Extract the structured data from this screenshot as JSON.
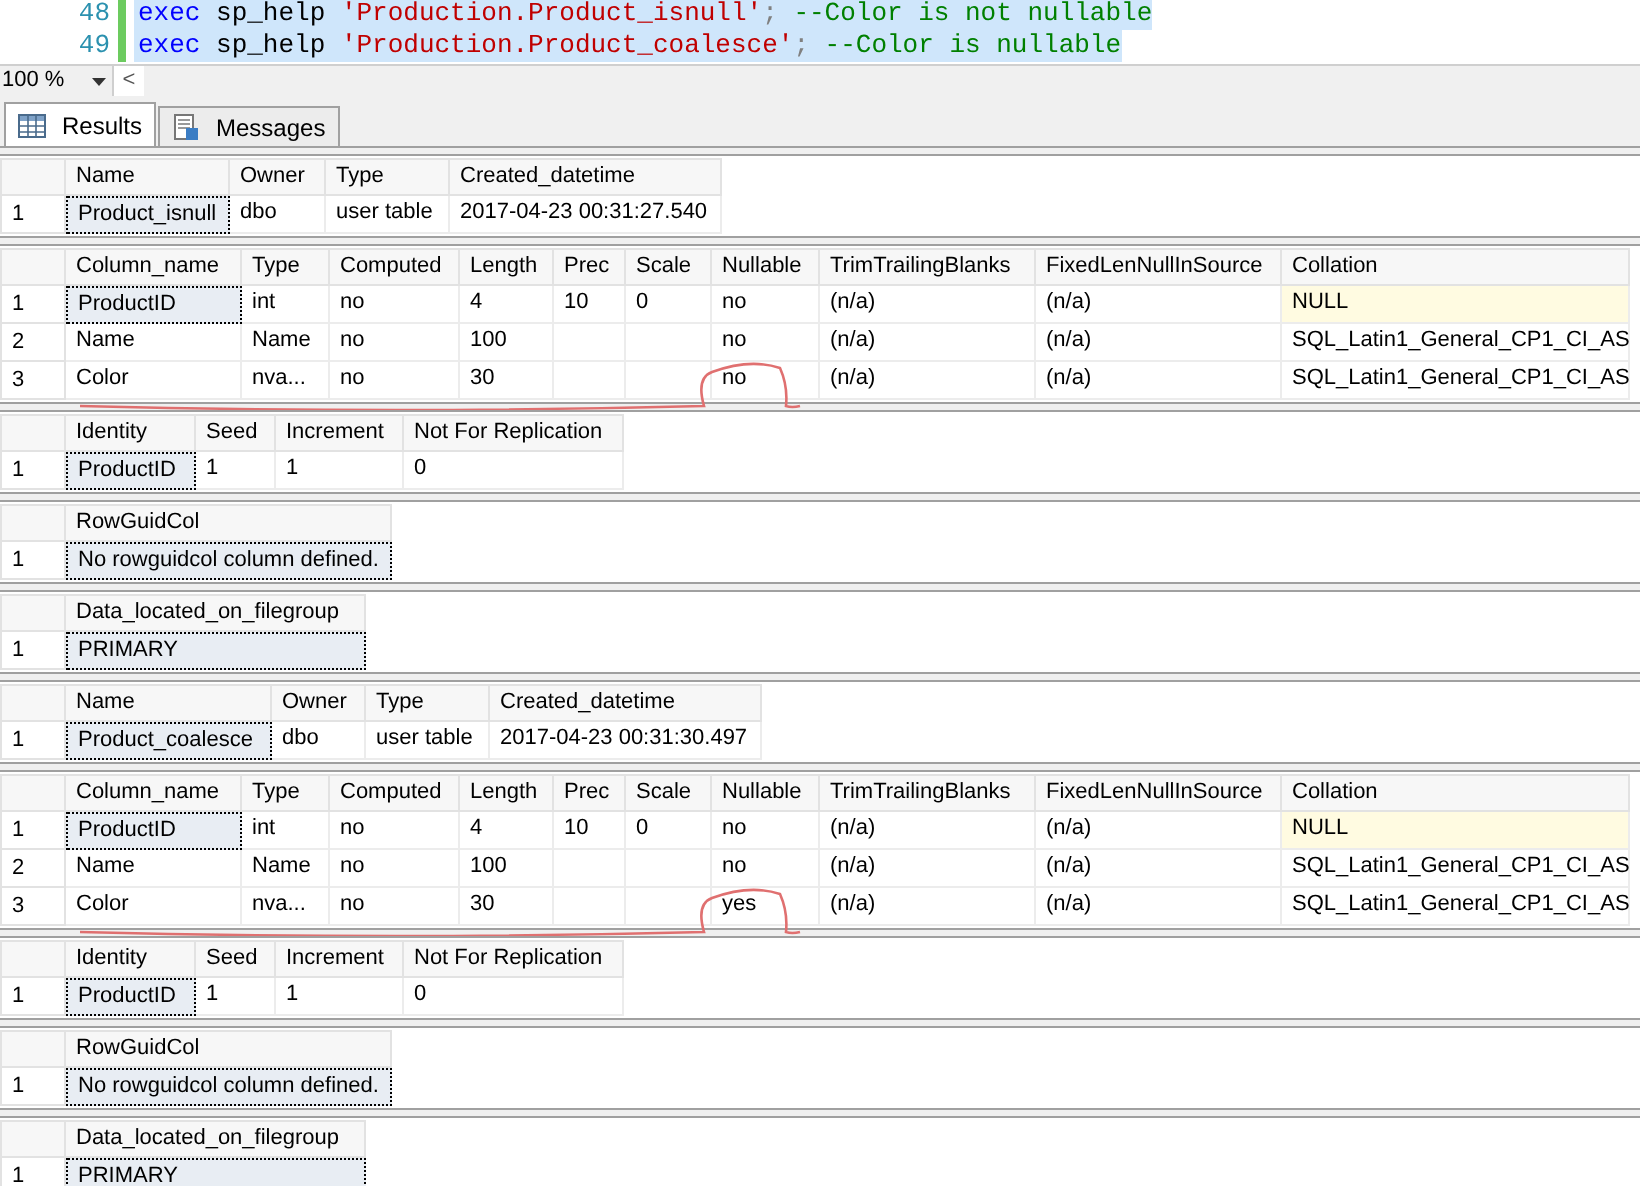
{
  "editor": {
    "lines": [
      {
        "number": "48",
        "selected": true,
        "tokens": [
          {
            "kind": "keyword",
            "text": "exec"
          },
          {
            "kind": "plain",
            "text": " sp_help "
          },
          {
            "kind": "string",
            "text": "'Production.Product_isnull'"
          },
          {
            "kind": "punct",
            "text": ";"
          },
          {
            "kind": "comment",
            "text": " --Color is not nullable"
          }
        ]
      },
      {
        "number": "49",
        "selected": true,
        "tokens": [
          {
            "kind": "keyword",
            "text": "exec"
          },
          {
            "kind": "plain",
            "text": " sp_help "
          },
          {
            "kind": "string",
            "text": "'Production.Product_coalesce'"
          },
          {
            "kind": "punct",
            "text": ";"
          },
          {
            "kind": "comment",
            "text": " --Color is nullable"
          }
        ]
      }
    ]
  },
  "zoom": {
    "value": "100 %",
    "scroll_left": "<"
  },
  "tabs": [
    {
      "label": "Results",
      "selected": true,
      "kind": "grid"
    },
    {
      "label": "Messages",
      "selected": false,
      "kind": "messages"
    }
  ],
  "grids": [
    {
      "annotated": false,
      "columns": [
        "Name",
        "Owner",
        "Type",
        "Created_datetime"
      ],
      "rows": [
        {
          "number": "1",
          "cells": [
            {
              "text": "Product_isnull",
              "focused": true
            },
            "dbo",
            "user table",
            "2017-04-23 00:31:27.540"
          ]
        }
      ]
    },
    {
      "annotated": true,
      "columns": [
        "Column_name",
        "Type",
        "Computed",
        "Length",
        "Prec",
        "Scale",
        "Nullable",
        "TrimTrailingBlanks",
        "FixedLenNullInSource",
        "Collation"
      ],
      "rows": [
        {
          "number": "1",
          "cells": [
            {
              "text": "ProductID",
              "focused": true
            },
            "int",
            "no",
            "4",
            "10",
            "0",
            "no",
            "(n/a)",
            "(n/a)",
            {
              "text": "NULL",
              "null": true
            }
          ]
        },
        {
          "number": "2",
          "cells": [
            "Name",
            "Name",
            "no",
            "100",
            "",
            "",
            "no",
            "(n/a)",
            "(n/a)",
            "SQL_Latin1_General_CP1_CI_AS"
          ]
        },
        {
          "number": "3",
          "cells": [
            "Color",
            "nva...",
            "no",
            "30",
            "",
            "",
            "no",
            "(n/a)",
            "(n/a)",
            "SQL_Latin1_General_CP1_CI_AS"
          ]
        }
      ]
    },
    {
      "annotated": false,
      "columns": [
        "Identity",
        "Seed",
        "Increment",
        "Not For Replication"
      ],
      "rows": [
        {
          "number": "1",
          "cells": [
            {
              "text": "ProductID",
              "focused": true
            },
            "1",
            "1",
            "0"
          ]
        }
      ]
    },
    {
      "annotated": false,
      "columns": [
        "RowGuidCol"
      ],
      "rows": [
        {
          "number": "1",
          "cells": [
            {
              "text": "No rowguidcol column defined.",
              "focused": true
            }
          ]
        }
      ]
    },
    {
      "annotated": false,
      "columns": [
        "Data_located_on_filegroup"
      ],
      "rows": [
        {
          "number": "1",
          "cells": [
            {
              "text": "PRIMARY",
              "focused": true
            }
          ]
        }
      ]
    },
    {
      "annotated": false,
      "columns": [
        "Name",
        "Owner",
        "Type",
        "Created_datetime"
      ],
      "rows": [
        {
          "number": "1",
          "cells": [
            {
              "text": "Product_coalesce",
              "focused": true
            },
            "dbo",
            "user table",
            "2017-04-23 00:31:30.497"
          ]
        }
      ]
    },
    {
      "annotated": true,
      "columns": [
        "Column_name",
        "Type",
        "Computed",
        "Length",
        "Prec",
        "Scale",
        "Nullable",
        "TrimTrailingBlanks",
        "FixedLenNullInSource",
        "Collation"
      ],
      "rows": [
        {
          "number": "1",
          "cells": [
            {
              "text": "ProductID",
              "focused": true
            },
            "int",
            "no",
            "4",
            "10",
            "0",
            "no",
            "(n/a)",
            "(n/a)",
            {
              "text": "NULL",
              "null": true
            }
          ]
        },
        {
          "number": "2",
          "cells": [
            "Name",
            "Name",
            "no",
            "100",
            "",
            "",
            "no",
            "(n/a)",
            "(n/a)",
            "SQL_Latin1_General_CP1_CI_AS"
          ]
        },
        {
          "number": "3",
          "cells": [
            "Color",
            "nva...",
            "no",
            "30",
            "",
            "",
            "yes",
            "(n/a)",
            "(n/a)",
            "SQL_Latin1_General_CP1_CI_AS"
          ]
        }
      ]
    },
    {
      "annotated": false,
      "columns": [
        "Identity",
        "Seed",
        "Increment",
        "Not For Replication"
      ],
      "rows": [
        {
          "number": "1",
          "cells": [
            {
              "text": "ProductID",
              "focused": true
            },
            "1",
            "1",
            "0"
          ]
        }
      ]
    },
    {
      "annotated": false,
      "columns": [
        "RowGuidCol"
      ],
      "rows": [
        {
          "number": "1",
          "cells": [
            {
              "text": "No rowguidcol column defined.",
              "focused": true
            }
          ]
        }
      ]
    },
    {
      "annotated": false,
      "columns": [
        "Data_located_on_filegroup"
      ],
      "rows": [
        {
          "number": "1",
          "cells": [
            {
              "text": "PRIMARY",
              "focused": true
            }
          ]
        }
      ]
    }
  ]
}
